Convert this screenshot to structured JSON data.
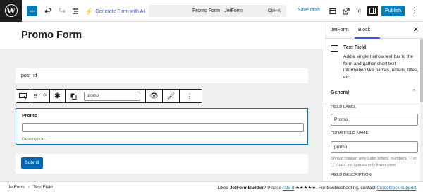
{
  "topbar": {
    "add_icon": "plus-icon",
    "generate_label": "Generate Form with AI",
    "document_title": "Promo Form · JetForm",
    "shortcut": "Ctrl+K",
    "save_draft": "Save draft",
    "publish": "Publish"
  },
  "canvas": {
    "page_title": "Promo Form",
    "post_id_label": "post_id",
    "toolbar": {
      "field_name_value": "promo"
    },
    "promo_field": {
      "label": "Promo",
      "description_placeholder": "Description..."
    },
    "submit_label": "Submit"
  },
  "sidebar": {
    "tabs": [
      "JetForm",
      "Block"
    ],
    "active_tab": "Block",
    "block": {
      "name": "Text Field",
      "description": "Add a single narrow text bar to the form and gather short text information like names, emails, titles, etc."
    },
    "section_title": "General",
    "field_label_label": "FIELD LABEL",
    "field_label_value": "Promo",
    "field_name_label": "FORM FIELD NAME",
    "field_name_value": "promo",
    "field_name_help": "Should contain only Latin letters, numbers, '-' or '_' chars, no spaces only lower case",
    "field_description_label": "FIELD DESCRIPTION"
  },
  "statusbar": {
    "breadcrumb": [
      "JetForm",
      "Text Field"
    ],
    "note_prefix": "Liked ",
    "note_brand": "JetFormBuilder",
    "note_mid": "? Please ",
    "note_rate": "rate it",
    "note_stars": " ★★★★★",
    "note_suffix": ". For troubleshooting, contact ",
    "note_support": "Crocoblock support",
    "note_end": "."
  },
  "colors": {
    "accent": "#007cba",
    "ai_link": "#3858e9",
    "dark": "#1e1e1e"
  }
}
